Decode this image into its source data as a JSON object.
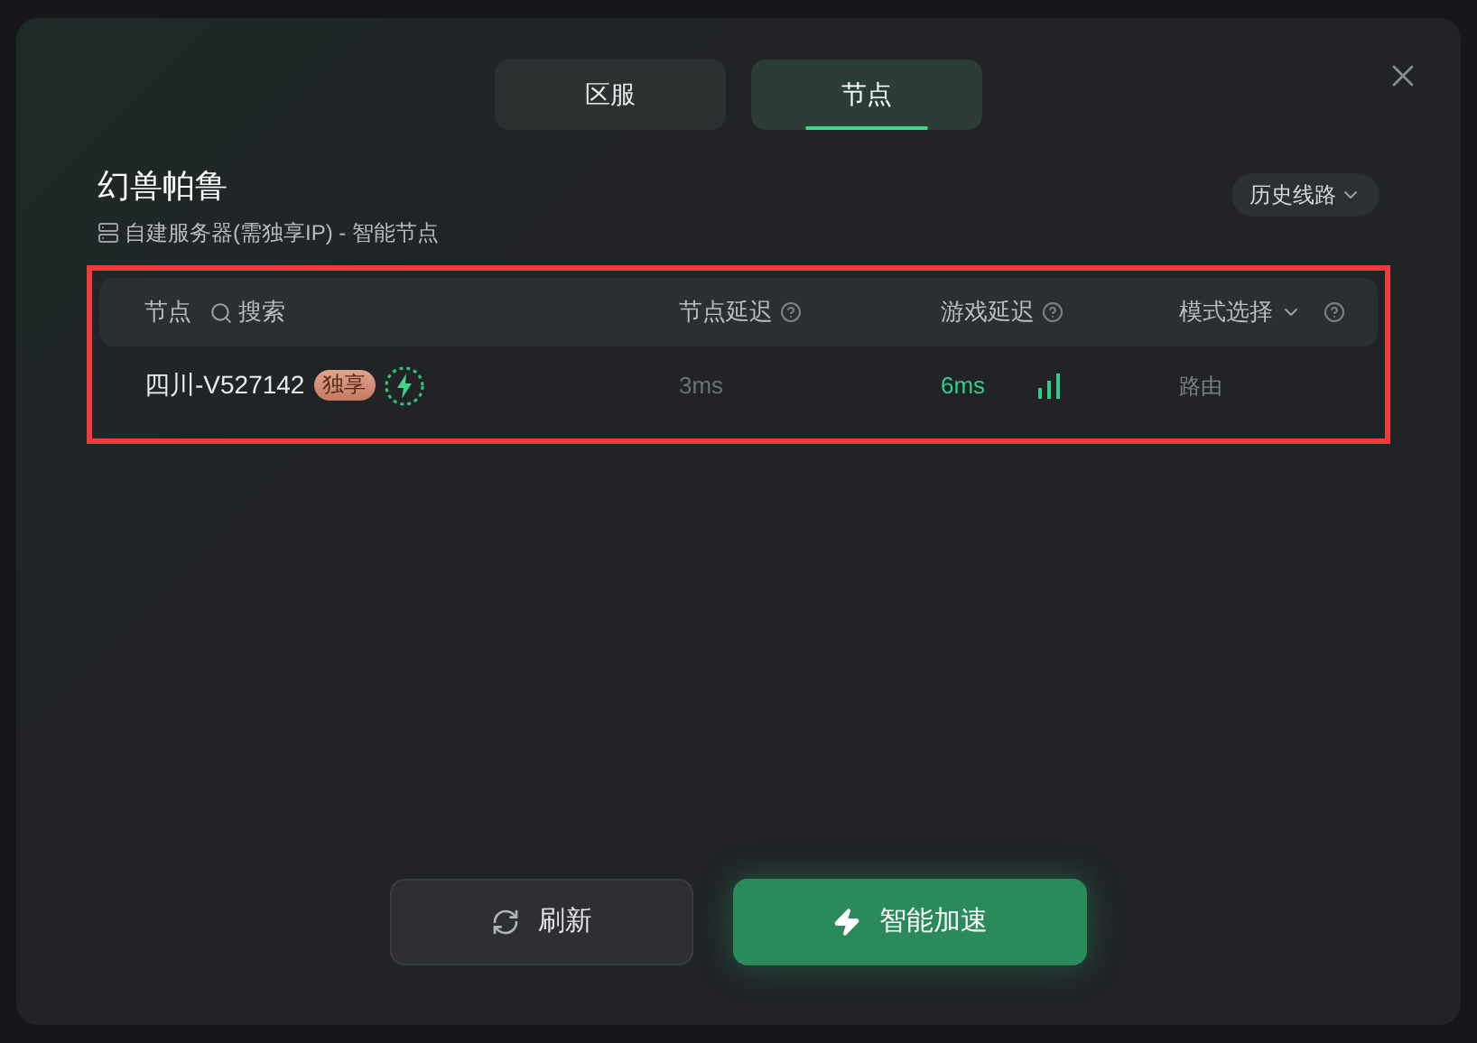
{
  "tabs": [
    {
      "label": "区服",
      "selected": false
    },
    {
      "label": "节点",
      "selected": true
    }
  ],
  "game": {
    "title": "幻兽帕鲁",
    "subtitle": "自建服务器(需独享IP) - 智能节点"
  },
  "history_button": "历史线路",
  "table": {
    "columns": [
      {
        "label": "节点",
        "search": "搜索"
      },
      {
        "label": "节点延迟",
        "help": true
      },
      {
        "label": "游戏延迟",
        "help": true
      },
      {
        "label": "模式选择",
        "dropdown": true,
        "help": true
      }
    ],
    "rows": [
      {
        "node": "四川-V527142",
        "badge": "独享",
        "smart": true,
        "node_latency": "3ms",
        "game_latency": "6ms",
        "mode": "路由"
      }
    ]
  },
  "buttons": [
    {
      "label": "刷新",
      "kind": "refresh"
    },
    {
      "label": "智能加速",
      "kind": "accelerate"
    }
  ]
}
